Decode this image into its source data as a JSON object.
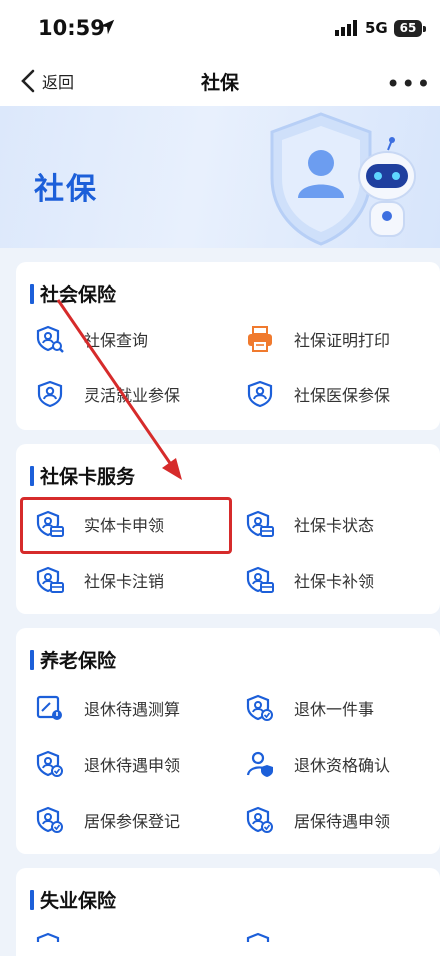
{
  "status_bar": {
    "time": "10:59",
    "network": "5G",
    "battery": "65"
  },
  "nav": {
    "back_label": "返回",
    "title": "社保",
    "more": "•••"
  },
  "banner": {
    "title": "社保"
  },
  "sections": [
    {
      "title": "社会保险",
      "items": [
        "社保查询",
        "社保证明打印",
        "灵活就业参保",
        "社保医保参保"
      ]
    },
    {
      "title": "社保卡服务",
      "items": [
        "实体卡申领",
        "社保卡状态",
        "社保卡注销",
        "社保卡补领"
      ]
    },
    {
      "title": "养老保险",
      "items": [
        "退休待遇测算",
        "退休一件事",
        "退休待遇申领",
        "退休资格确认",
        "居保参保登记",
        "居保待遇申领"
      ]
    },
    {
      "title": "失业保险",
      "items": []
    }
  ],
  "colors": {
    "accent": "#1c5fd9",
    "highlight": "#d62b2b",
    "printer": "#f07a2e"
  }
}
